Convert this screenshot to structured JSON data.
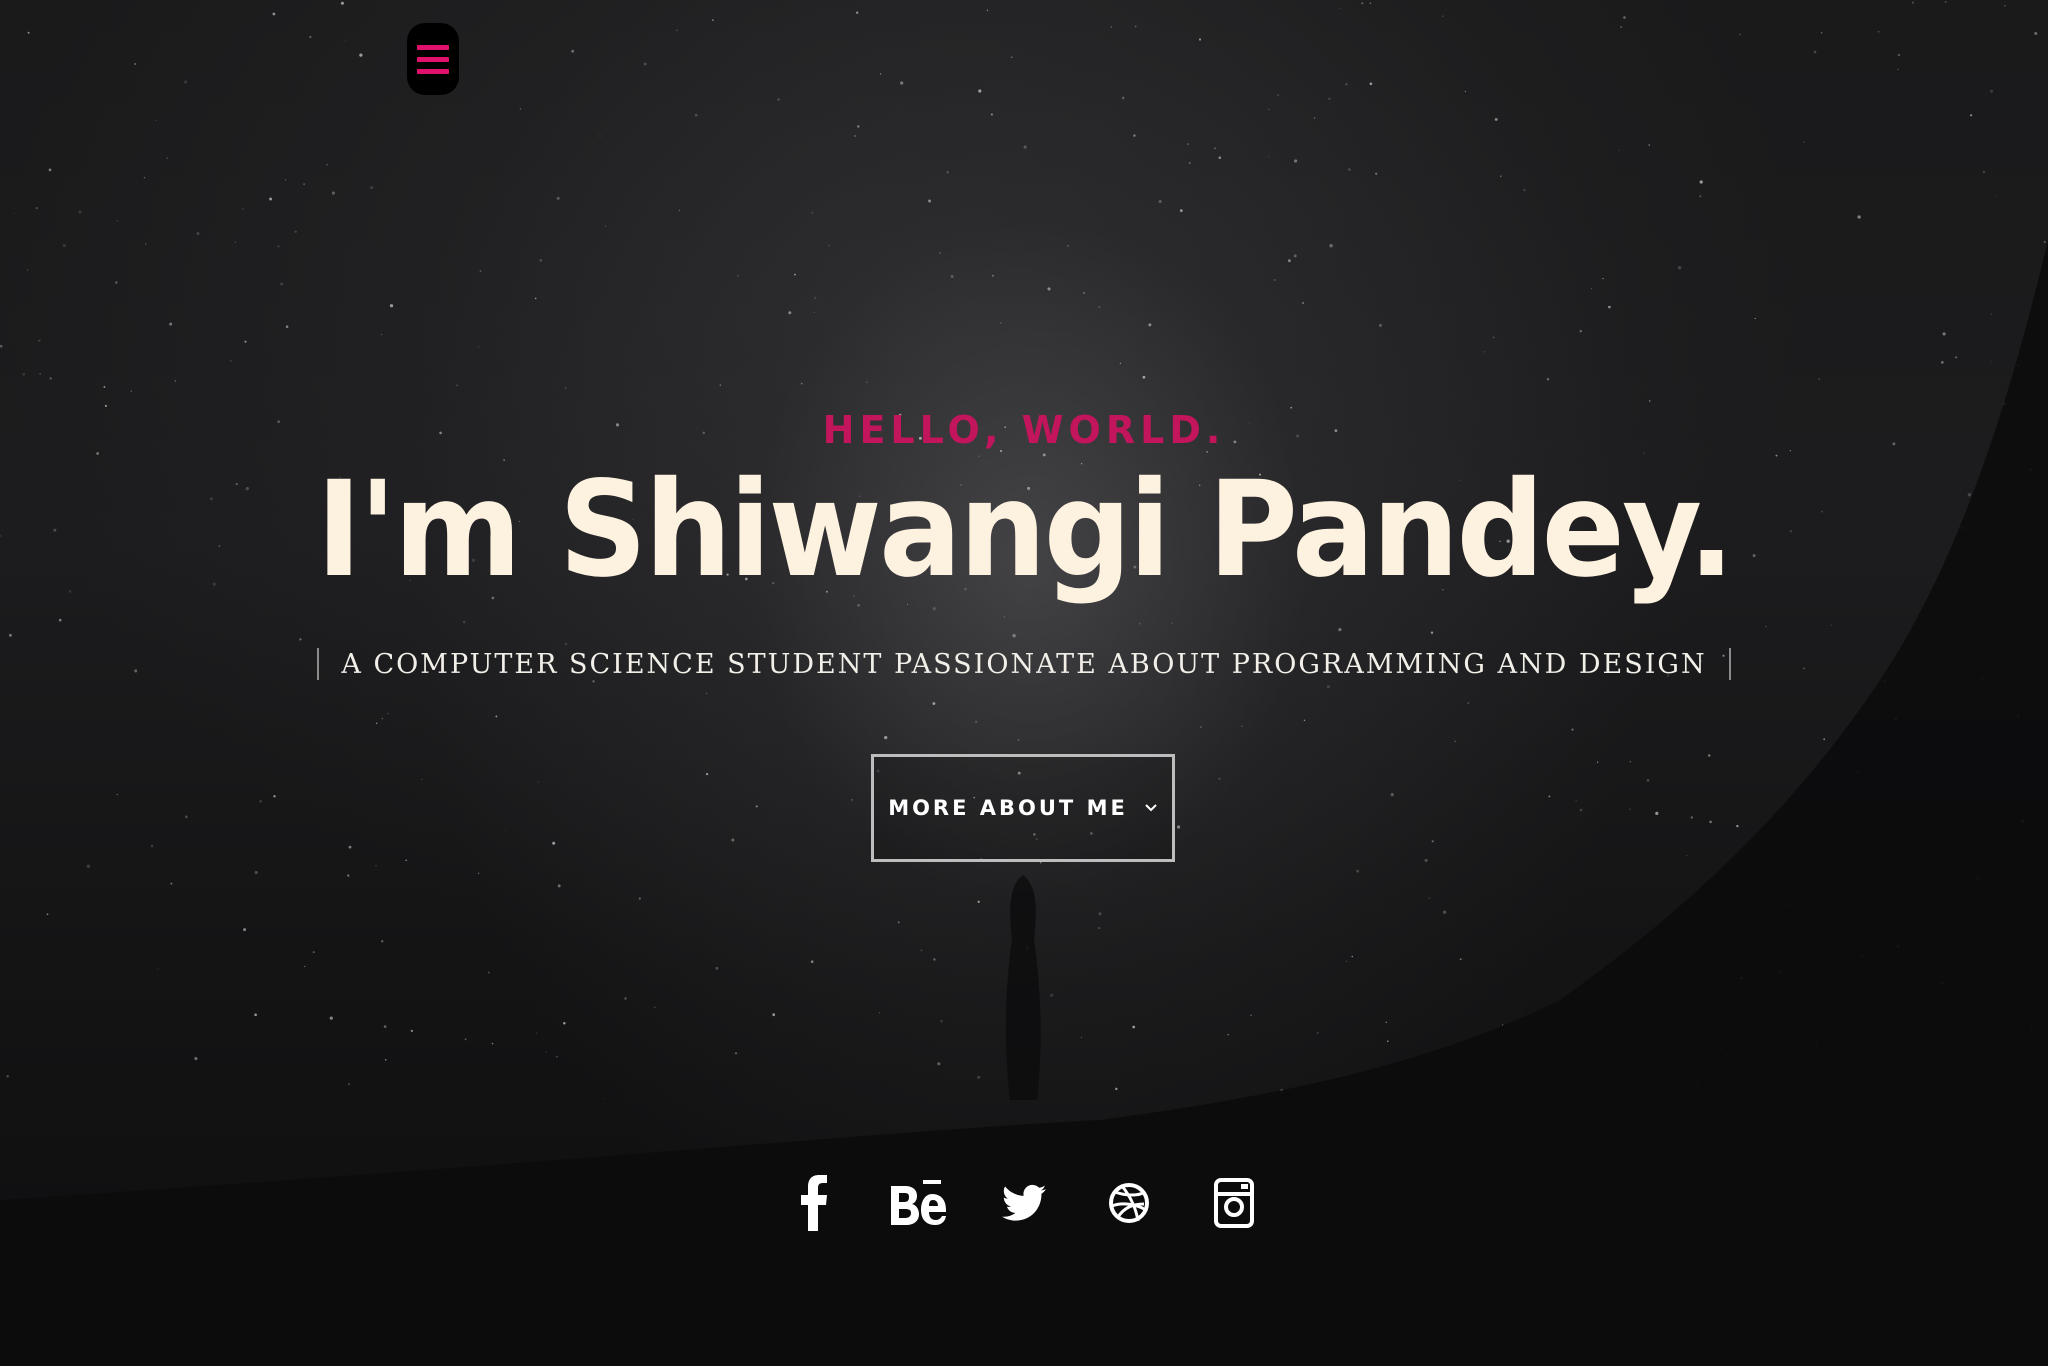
{
  "nav": {
    "menu_icon": "hamburger-icon",
    "accent_color": "#e0116d"
  },
  "intro": {
    "pretitle": "HELLO, WORLD.",
    "title": "I'm Shiwangi Pandey.",
    "position": "A COMPUTER SCIENCE STUDENT PASSIONATE ABOUT PROGRAMMING AND DESIGN",
    "button_label": "MORE ABOUT ME",
    "button_icon": "chevron-down-icon"
  },
  "social": [
    {
      "name": "facebook-icon"
    },
    {
      "name": "behance-icon"
    },
    {
      "name": "twitter-icon"
    },
    {
      "name": "dribbble-icon"
    },
    {
      "name": "instagram-icon"
    }
  ],
  "colors": {
    "title": "#fdf1df",
    "pretitle": "#c2155c",
    "background": "#0f0f10"
  }
}
